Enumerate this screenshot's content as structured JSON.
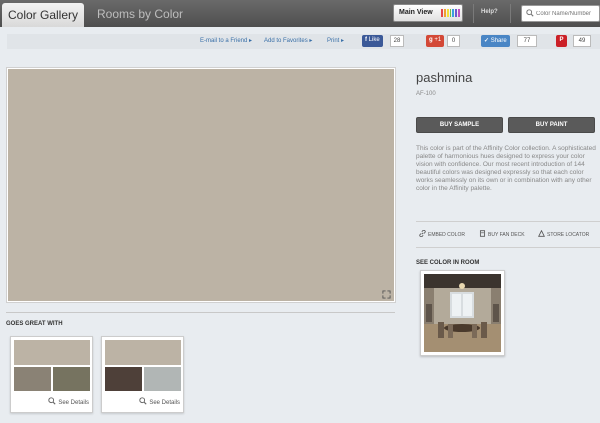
{
  "header": {
    "tab_gallery": "Color Gallery",
    "tab_rooms": "Rooms by Color",
    "main_view_label": "Main View",
    "help_label": "Help?",
    "search_placeholder": "Color Name/Number"
  },
  "share": {
    "email_label": "E-mail to a Friend",
    "favorites_label": "Add to Favorites",
    "print_label": "Print",
    "like_label": "Like",
    "like_count": "28",
    "gplus_label": "+1",
    "gplus_count": "0",
    "share_label": "Share",
    "share_count": "77",
    "pin_count": "49"
  },
  "color": {
    "name": "pashmina",
    "code": "AF-100",
    "hex": "#bcb3a5",
    "description": "This color is part of the Affinity Color collection. A sophisticated palette of harmonious hues designed to express your color vision with confidence. Our most recent introduction of 144 beautiful colors was designed expressly so that each color works seamlessly on its own or in combination with any other color in the Affinity palette."
  },
  "actions": {
    "buy_sample": "BUY SAMPLE",
    "buy_paint": "BUY PAINT",
    "embed_color": "EMBED COLOR",
    "buy_fan_deck": "BUY FAN DECK",
    "store_locator": "STORE LOCATOR"
  },
  "goes_great_with": {
    "title": "GOES GREAT WITH",
    "details_label": "See Details",
    "combos": [
      {
        "top": "#bcb3a5",
        "left": "#8a8275",
        "right": "#767360"
      },
      {
        "top": "#bcb3a5",
        "left": "#4e4039",
        "right": "#b1b6b5"
      }
    ]
  },
  "see_in_room": {
    "title": "SEE COLOR IN ROOM"
  },
  "colors": {
    "topbar": "#555555",
    "link": "#3a70a8",
    "facebook": "#3b5998",
    "gplus": "#d34836",
    "share": "#4a86c5",
    "pinterest": "#cb2027",
    "button": "#5a5a5a"
  }
}
